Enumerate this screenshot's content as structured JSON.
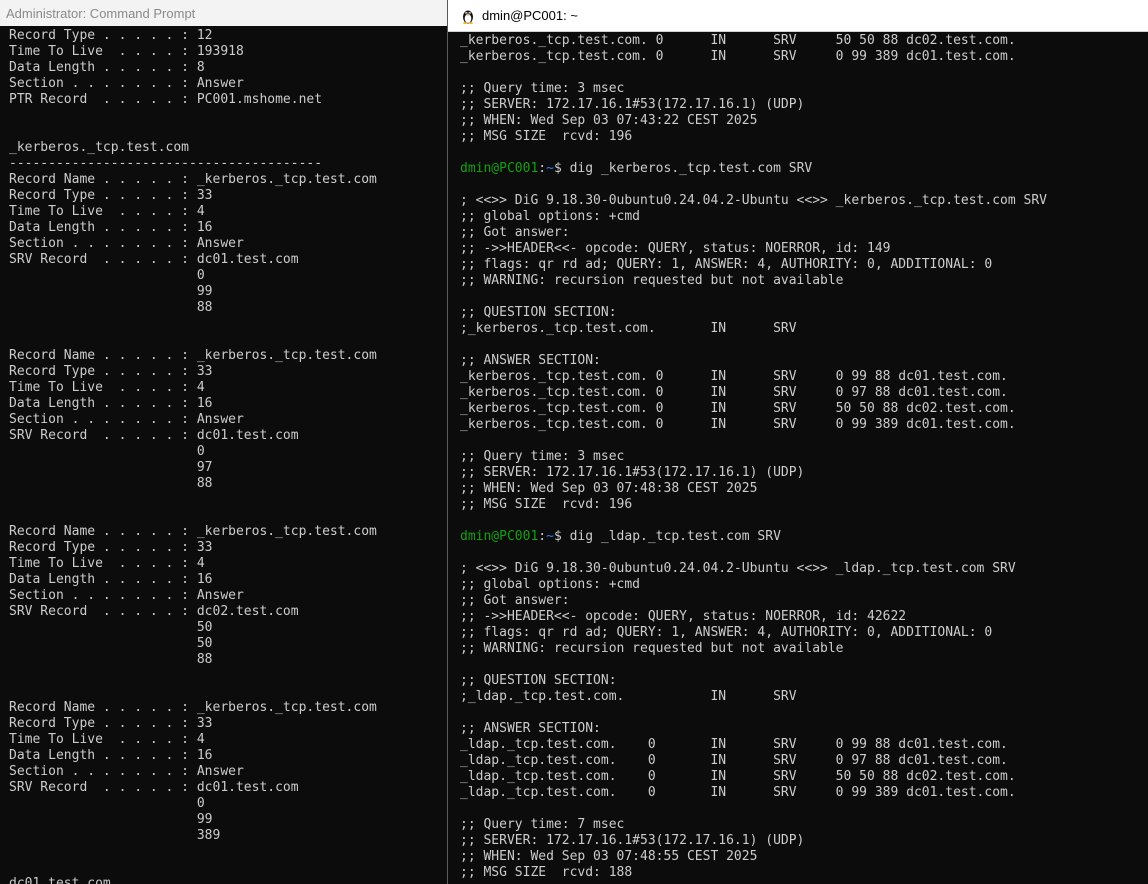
{
  "cmd_window": {
    "title": "Administrator: Command Prompt",
    "lines": [
      "Record Type . . . . . : 12",
      "Time To Live  . . . . : 193918",
      "Data Length . . . . . : 8",
      "Section . . . . . . . : Answer",
      "PTR Record  . . . . . : PC001.mshome.net",
      "",
      "",
      "_kerberos._tcp.test.com",
      "----------------------------------------",
      "Record Name . . . . . : _kerberos._tcp.test.com",
      "Record Type . . . . . : 33",
      "Time To Live  . . . . : 4",
      "Data Length . . . . . : 16",
      "Section . . . . . . . : Answer",
      "SRV Record  . . . . . : dc01.test.com",
      "                        0",
      "                        99",
      "                        88",
      "",
      "",
      "Record Name . . . . . : _kerberos._tcp.test.com",
      "Record Type . . . . . : 33",
      "Time To Live  . . . . : 4",
      "Data Length . . . . . : 16",
      "Section . . . . . . . : Answer",
      "SRV Record  . . . . . : dc01.test.com",
      "                        0",
      "                        97",
      "                        88",
      "",
      "",
      "Record Name . . . . . : _kerberos._tcp.test.com",
      "Record Type . . . . . : 33",
      "Time To Live  . . . . : 4",
      "Data Length . . . . . : 16",
      "Section . . . . . . . : Answer",
      "SRV Record  . . . . . : dc02.test.com",
      "                        50",
      "                        50",
      "                        88",
      "",
      "",
      "Record Name . . . . . : _kerberos._tcp.test.com",
      "Record Type . . . . . : 33",
      "Time To Live  . . . . : 4",
      "Data Length . . . . . : 16",
      "Section . . . . . . . : Answer",
      "SRV Record  . . . . . : dc01.test.com",
      "                        0",
      "                        99",
      "                        389",
      "",
      "",
      "dc01.test.com"
    ]
  },
  "wsl_window": {
    "title": "dmin@PC001: ~",
    "icon": "tux-icon",
    "prompt": {
      "user_host": "dmin@PC001",
      "sep": ":",
      "path": "~",
      "sym": "$ "
    },
    "lines": [
      {
        "text": "_kerberos._tcp.test.com. 0      IN      SRV     50 50 88 dc02.test.com."
      },
      {
        "text": "_kerberos._tcp.test.com. 0      IN      SRV     0 99 389 dc01.test.com."
      },
      {
        "text": ""
      },
      {
        "text": ";; Query time: 3 msec"
      },
      {
        "text": ";; SERVER: 172.17.16.1#53(172.17.16.1) (UDP)"
      },
      {
        "text": ";; WHEN: Wed Sep 03 07:43:22 CEST 2025"
      },
      {
        "text": ";; MSG SIZE  rcvd: 196"
      },
      {
        "text": ""
      },
      {
        "prompt": true,
        "cmd": "dig _kerberos._tcp.test.com SRV"
      },
      {
        "text": ""
      },
      {
        "text": "; <<>> DiG 9.18.30-0ubuntu0.24.04.2-Ubuntu <<>> _kerberos._tcp.test.com SRV"
      },
      {
        "text": ";; global options: +cmd"
      },
      {
        "text": ";; Got answer:"
      },
      {
        "text": ";; ->>HEADER<<- opcode: QUERY, status: NOERROR, id: 149"
      },
      {
        "text": ";; flags: qr rd ad; QUERY: 1, ANSWER: 4, AUTHORITY: 0, ADDITIONAL: 0"
      },
      {
        "text": ";; WARNING: recursion requested but not available"
      },
      {
        "text": ""
      },
      {
        "text": ";; QUESTION SECTION:"
      },
      {
        "text": ";_kerberos._tcp.test.com.       IN      SRV"
      },
      {
        "text": ""
      },
      {
        "text": ";; ANSWER SECTION:"
      },
      {
        "text": "_kerberos._tcp.test.com. 0      IN      SRV     0 99 88 dc01.test.com."
      },
      {
        "text": "_kerberos._tcp.test.com. 0      IN      SRV     0 97 88 dc01.test.com."
      },
      {
        "text": "_kerberos._tcp.test.com. 0      IN      SRV     50 50 88 dc02.test.com."
      },
      {
        "text": "_kerberos._tcp.test.com. 0      IN      SRV     0 99 389 dc01.test.com."
      },
      {
        "text": ""
      },
      {
        "text": ";; Query time: 3 msec"
      },
      {
        "text": ";; SERVER: 172.17.16.1#53(172.17.16.1) (UDP)"
      },
      {
        "text": ";; WHEN: Wed Sep 03 07:48:38 CEST 2025"
      },
      {
        "text": ";; MSG SIZE  rcvd: 196"
      },
      {
        "text": ""
      },
      {
        "prompt": true,
        "cmd": "dig _ldap._tcp.test.com SRV"
      },
      {
        "text": ""
      },
      {
        "text": "; <<>> DiG 9.18.30-0ubuntu0.24.04.2-Ubuntu <<>> _ldap._tcp.test.com SRV"
      },
      {
        "text": ";; global options: +cmd"
      },
      {
        "text": ";; Got answer:"
      },
      {
        "text": ";; ->>HEADER<<- opcode: QUERY, status: NOERROR, id: 42622"
      },
      {
        "text": ";; flags: qr rd ad; QUERY: 1, ANSWER: 4, AUTHORITY: 0, ADDITIONAL: 0"
      },
      {
        "text": ";; WARNING: recursion requested but not available"
      },
      {
        "text": ""
      },
      {
        "text": ";; QUESTION SECTION:"
      },
      {
        "text": ";_ldap._tcp.test.com.           IN      SRV"
      },
      {
        "text": ""
      },
      {
        "text": ";; ANSWER SECTION:"
      },
      {
        "text": "_ldap._tcp.test.com.    0       IN      SRV     0 99 88 dc01.test.com."
      },
      {
        "text": "_ldap._tcp.test.com.    0       IN      SRV     0 97 88 dc01.test.com."
      },
      {
        "text": "_ldap._tcp.test.com.    0       IN      SRV     50 50 88 dc02.test.com."
      },
      {
        "text": "_ldap._tcp.test.com.    0       IN      SRV     0 99 389 dc01.test.com."
      },
      {
        "text": ""
      },
      {
        "text": ";; Query time: 7 msec"
      },
      {
        "text": ";; SERVER: 172.17.16.1#53(172.17.16.1) (UDP)"
      },
      {
        "text": ";; WHEN: Wed Sep 03 07:48:55 CEST 2025"
      },
      {
        "text": ";; MSG SIZE  rcvd: 188"
      }
    ]
  }
}
